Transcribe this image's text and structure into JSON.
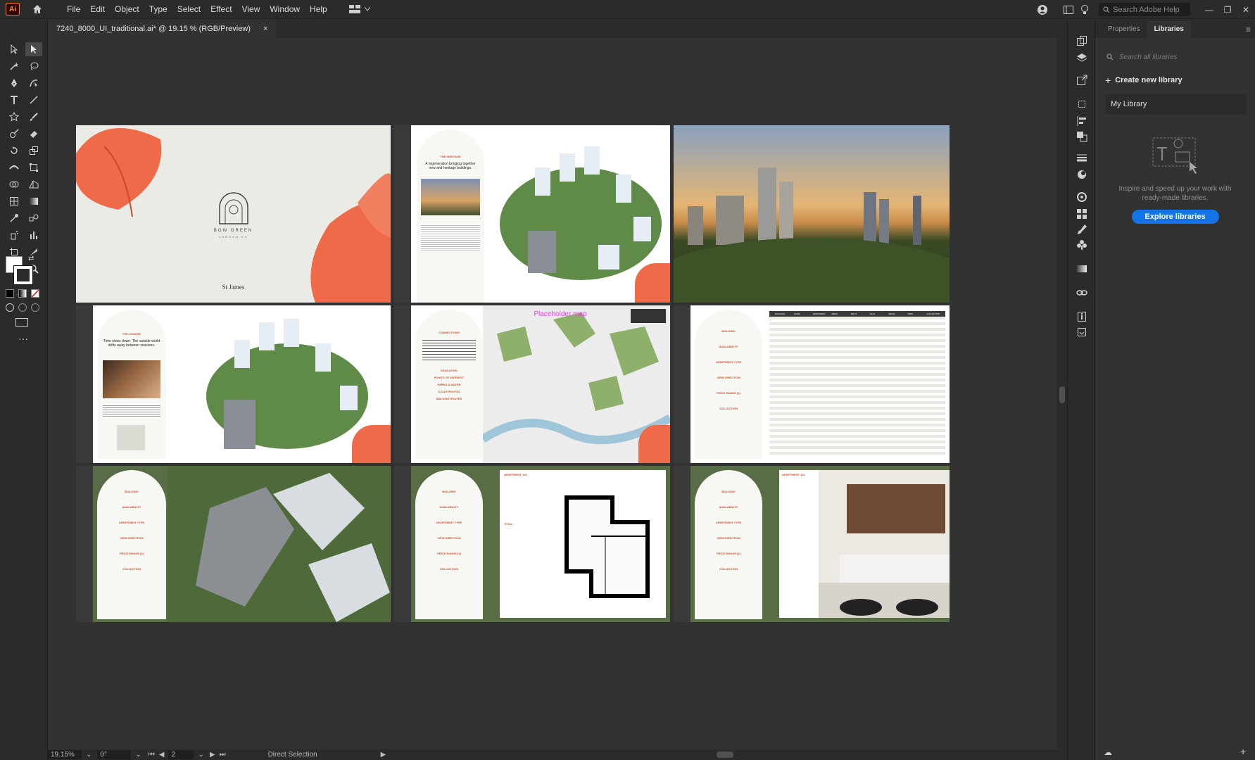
{
  "menubar": {
    "logo": "Ai",
    "items": [
      "File",
      "Edit",
      "Object",
      "Type",
      "Select",
      "Effect",
      "View",
      "Window",
      "Help"
    ],
    "search_placeholder": "Search Adobe Help"
  },
  "document": {
    "tab_title": "7240_8000_UI_traditional.ai* @ 19.15 % (RGB/Preview)",
    "close": "×"
  },
  "statusbar": {
    "zoom": "19.15%",
    "rotation": "0°",
    "artboard": "2",
    "tool": "Direct Selection"
  },
  "panel": {
    "tabs": [
      "Properties",
      "Libraries"
    ],
    "active_tab": "Libraries",
    "search_placeholder": "Search all libraries",
    "create_label": "Create new library",
    "my_library": "My Library",
    "inspire_text": "Inspire and speed up your work with ready-made libraries.",
    "explore_label": "Explore libraries"
  },
  "artboards": {
    "a1": {
      "brand": "BOW GREEN",
      "sub": "LONDON E3",
      "developer": "St James"
    },
    "a2": {
      "heading": "THE HERITAGE",
      "tagline": "A regeneration bringing together new and heritage buildings."
    },
    "a4": {
      "heading": "THE LOUNGE",
      "tagline": "Time slows down. The outside world drifts away between sessions."
    },
    "a5": {
      "heading": "CONNECTIONS",
      "map_label": "Placeholder map",
      "menu": [
        "EDUCATION",
        "POINTS OF INTEREST",
        "PARKS & WATER",
        "CYCLE ROUTES",
        "WALKING ROUTES"
      ]
    },
    "filters": {
      "sections": [
        "BUILDING",
        "AVAILABILITY",
        "APARTMENT TYPE",
        "VIEW DIRECTION",
        "PRICE RANGE (£)",
        "COLLECTION"
      ]
    },
    "a6": {
      "columns": [
        "BUILDING",
        "LEVEL",
        "APARTMENT",
        "BEDS",
        "SQ FT",
        "SQ M",
        "PRICE",
        "VIEW",
        "COLLECTION"
      ]
    },
    "a8": {
      "heading": "APARTMENT 123",
      "total": "TOTAL"
    },
    "a9": {
      "heading": "APARTMENT 123"
    }
  },
  "colors": {
    "accent": "#e04a2a",
    "explore": "#1473e6",
    "map_label": "#e83ee8"
  }
}
